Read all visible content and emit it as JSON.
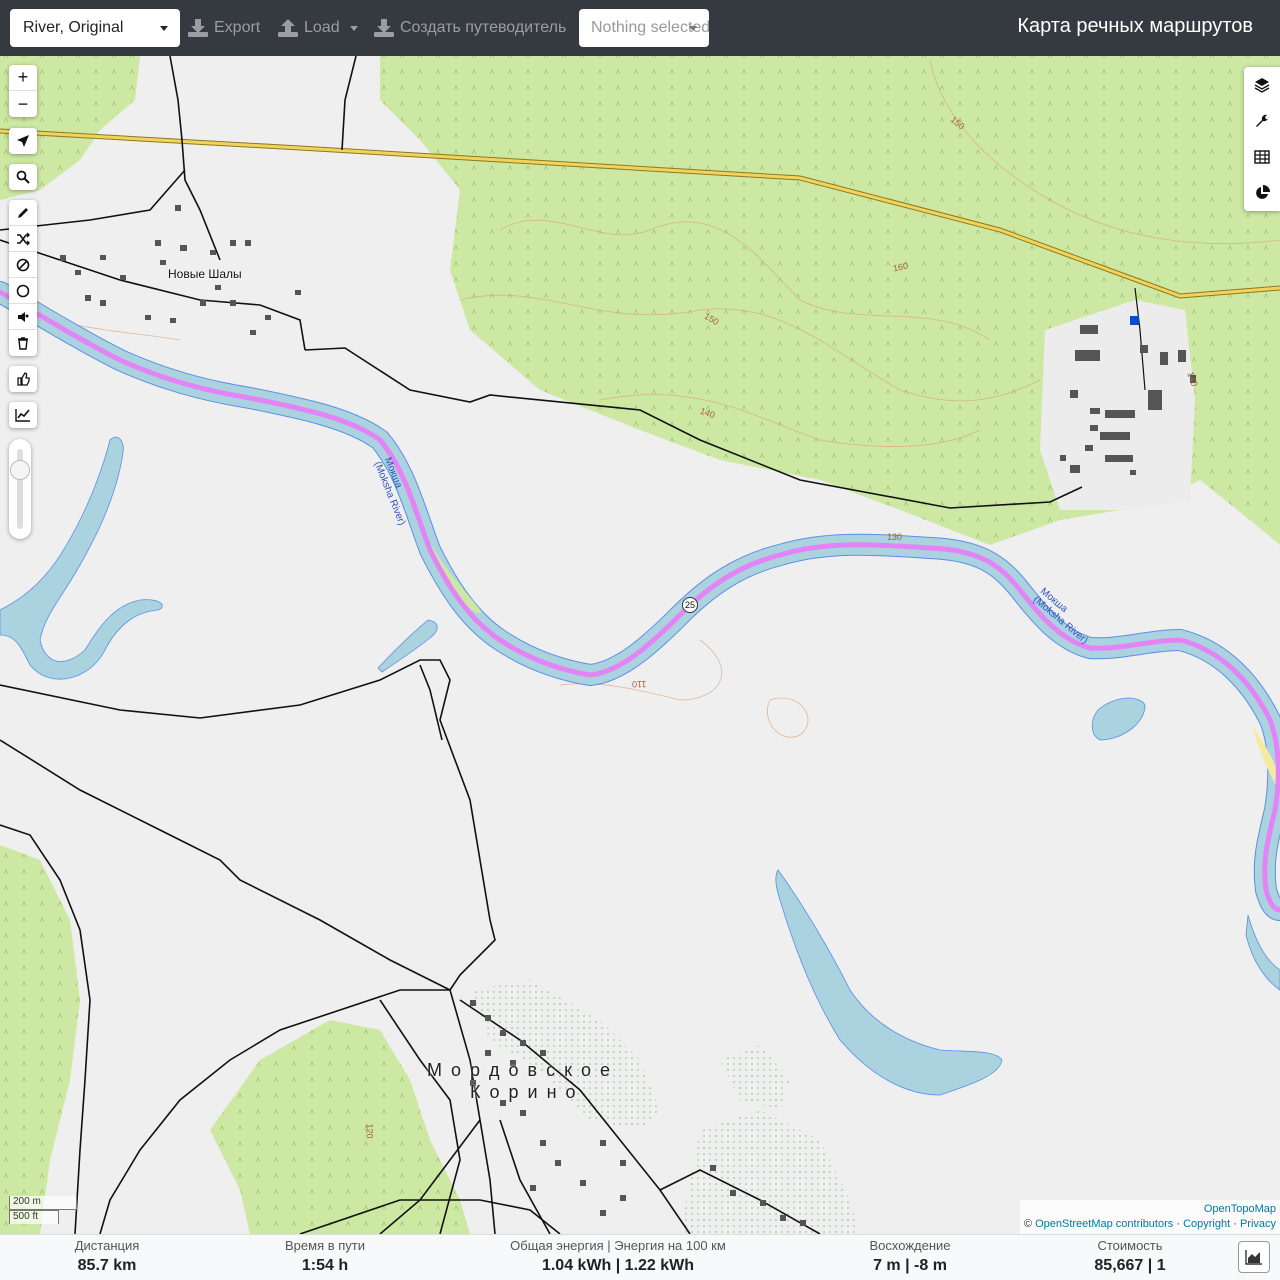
{
  "header": {
    "profile_select": "River, Original",
    "export_label": "Export",
    "load_label": "Load",
    "guide_label": "Создать путеводитель",
    "track_select_placeholder": "Nothing selected",
    "brand": "Карта речных маршрутов"
  },
  "map": {
    "zoom_in": "+",
    "zoom_out": "−",
    "place_names": {
      "village_north": "Новые Шалы",
      "village_south_1": "М о р д о в с к о е",
      "village_south_2": "К о р и н о",
      "river_1": "Мокша",
      "river_1_en": "(Moksha River)",
      "river_2": "Мокша",
      "river_2_en": "(Moksha River)"
    },
    "contours": [
      "150",
      "160",
      "150",
      "140",
      "140",
      "130",
      "110",
      "120"
    ],
    "waypoint_number": "25",
    "scale_metric": "200 m",
    "scale_imperial": "500 ft",
    "attribution": {
      "tiles": "OpenTopoMap",
      "osm": "OpenStreetMap contributors",
      "copyright": "Copyright",
      "privacy": "Privacy",
      "copy_sign": "©",
      "sep": "·"
    }
  },
  "stats": {
    "distance": {
      "label": "Дистанция",
      "value": "85.7 km"
    },
    "duration": {
      "label": "Время в пути",
      "value": "1:54 h"
    },
    "energy": {
      "label": "Общая энергия | Энергия на 100 км",
      "value": "1.04 kWh | 1.22 kWh"
    },
    "ascent": {
      "label": "Восхождение",
      "value": "7 m | -8 m"
    },
    "cost": {
      "label": "Стоимость",
      "value": "85,667 | 1"
    }
  },
  "colors": {
    "navbar": "#343a40",
    "forest": "#cde8a3",
    "water": "#aad3df",
    "route": "#e383f5",
    "road": "#f2d35c"
  }
}
